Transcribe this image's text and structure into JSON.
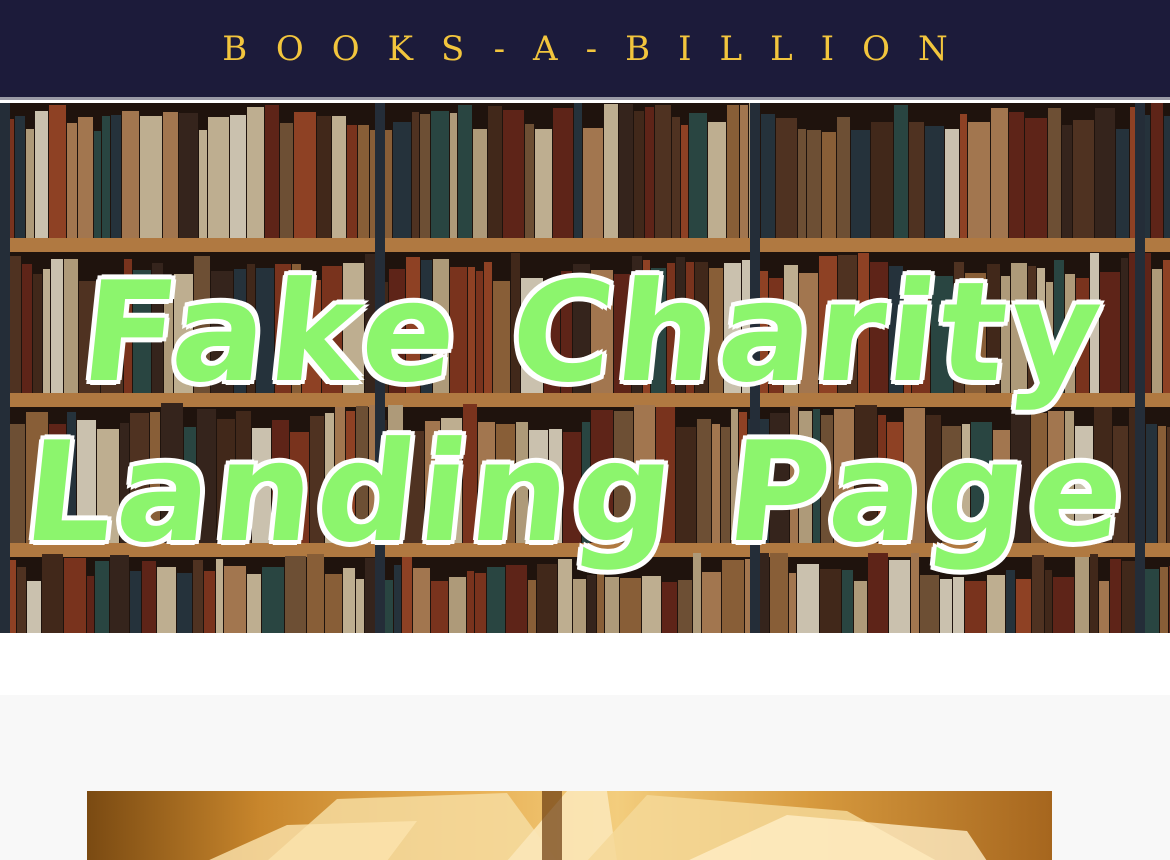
{
  "header": {
    "brand": "Books-A-Billion",
    "brand_color": "#f2c53d",
    "background_color": "#1c1b3a"
  },
  "hero": {
    "title_line1": "Fake Charity",
    "title_line2": "Landing Page",
    "title_color": "#8cf56d",
    "background": "bookshelf photo"
  },
  "content": {
    "image": "open book photo"
  }
}
